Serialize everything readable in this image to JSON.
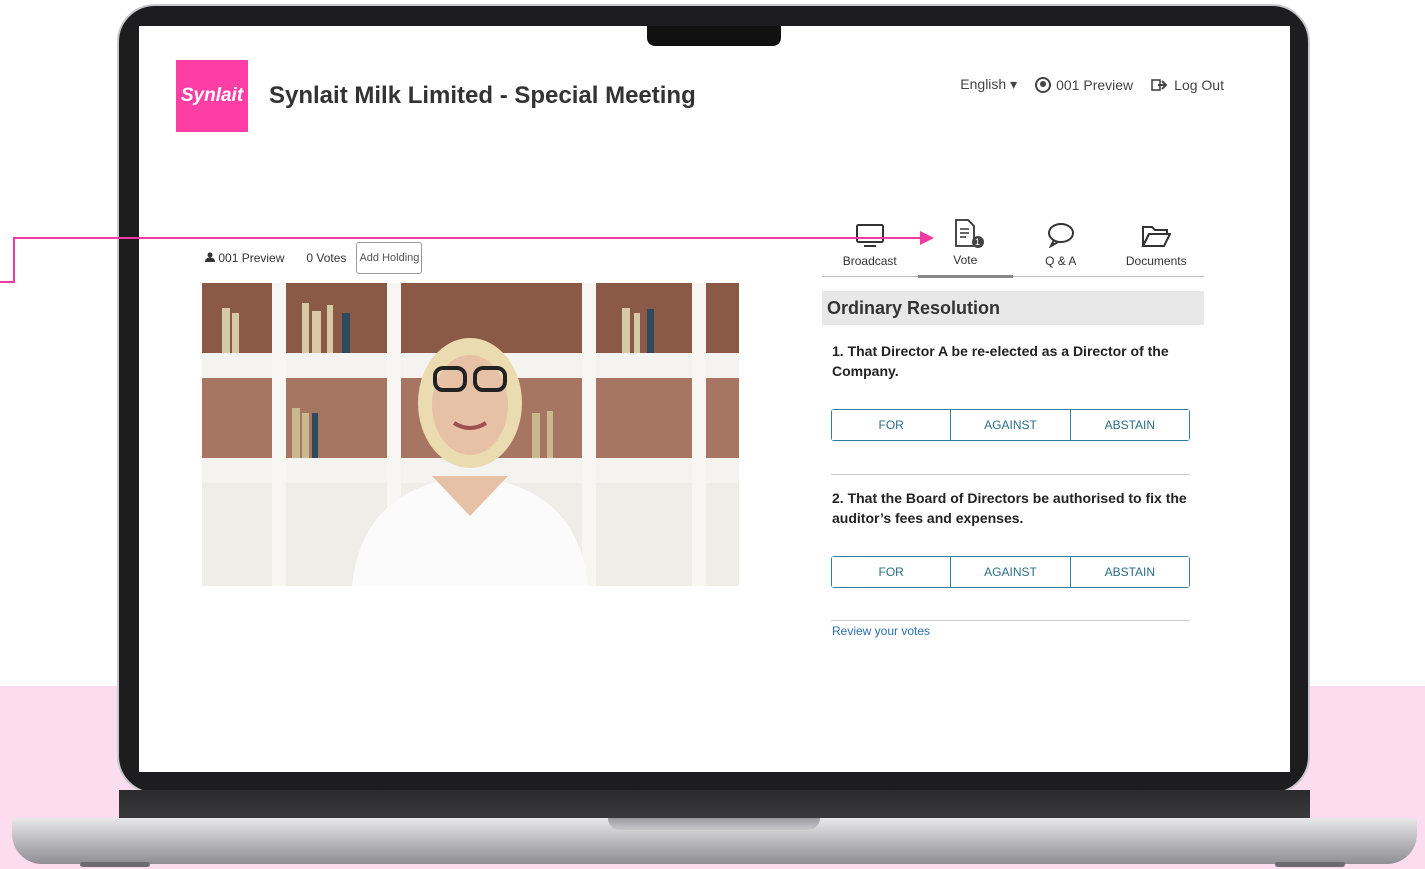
{
  "app": {
    "logo_text": "Synlait",
    "title": "Synlait Milk Limited - Special Meeting",
    "brand_color": "#ff3ea5"
  },
  "topnav": {
    "language": "English ▾",
    "user_label": "001 Preview",
    "logout_label": "Log Out"
  },
  "userbar": {
    "user": "001 Preview",
    "votes": "0  Votes",
    "add_holding": "Add Holding"
  },
  "tabs": [
    {
      "label": "Broadcast",
      "icon": "monitor-icon"
    },
    {
      "label": "Vote",
      "icon": "document-icon",
      "badge": "1"
    },
    {
      "label": "Q & A",
      "icon": "chat-bubble-icon"
    },
    {
      "label": "Documents",
      "icon": "folder-icon"
    }
  ],
  "voting": {
    "header": "Ordinary Resolution",
    "resolutions": [
      {
        "text": "1. That Director A be re-elected as a Director of the Company.",
        "options": [
          "FOR",
          "AGAINST",
          "ABSTAIN"
        ]
      },
      {
        "text": "2. That the Board of Directors be authorised to fix the auditor’s fees and expenses.",
        "options": [
          "FOR",
          "AGAINST",
          "ABSTAIN"
        ]
      }
    ],
    "review_link": "Review your votes",
    "accent": "#2f7f9b"
  }
}
